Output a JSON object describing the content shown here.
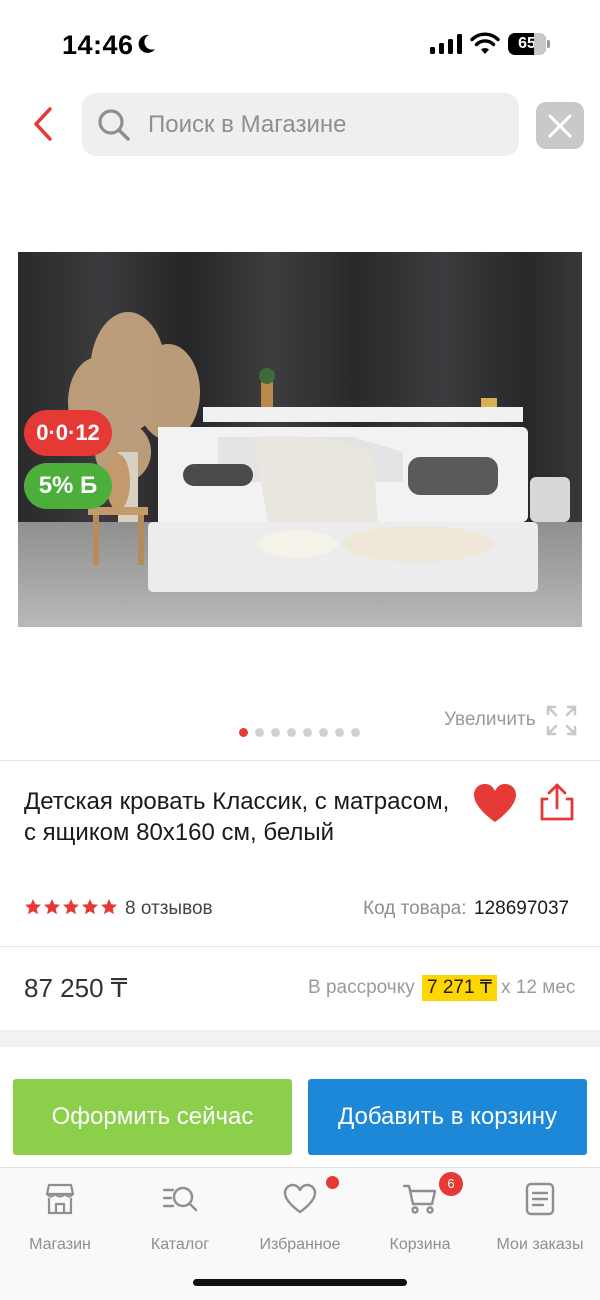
{
  "status_bar": {
    "time": "14:46",
    "battery": "65",
    "battery_level": 0.65
  },
  "search": {
    "placeholder": "Поиск в Магазине"
  },
  "product": {
    "badge_installment": "0·0·12",
    "badge_bonus": "5% Б",
    "zoom_label": "Увеличить",
    "image_count": 8,
    "active_image": 1,
    "title": "Детская кровать Классик, с матрасом, с ящиком 80х160 см, белый",
    "rating": 5,
    "reviews": "8 отзывов",
    "sku_label": "Код товара:",
    "sku_value": "128697037",
    "price": "87 250 ₸",
    "installment_label": "В рассрочку",
    "installment_amount": "7 271 ₸",
    "installment_term": "х 12 мес"
  },
  "actions": {
    "buy_now": "Оформить сейчас",
    "add_to_cart": "Добавить в корзину"
  },
  "tab_bar": {
    "items": [
      {
        "label": "Магазин",
        "icon": "store-icon"
      },
      {
        "label": "Каталог",
        "icon": "catalog-search-icon"
      },
      {
        "label": "Избранное",
        "icon": "heart-outline-icon"
      },
      {
        "label": "Корзина",
        "icon": "cart-icon"
      },
      {
        "label": "Мои заказы",
        "icon": "orders-icon"
      }
    ],
    "cart_count": "6"
  },
  "colors": {
    "accent_red": "#e53935",
    "green_button": "#8ccf4a",
    "blue_button": "#1e88d8",
    "installment_highlight": "#ffd600"
  }
}
